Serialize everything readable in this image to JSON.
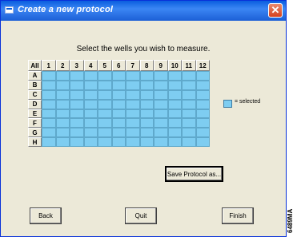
{
  "window": {
    "title": "Create a new protocol",
    "close_label": "✕"
  },
  "instruction": "Select the wells you wish to measure.",
  "grid": {
    "corner_label": "All",
    "columns": [
      "1",
      "2",
      "3",
      "4",
      "5",
      "6",
      "7",
      "8",
      "9",
      "10",
      "11",
      "12"
    ],
    "rows": [
      "A",
      "B",
      "C",
      "D",
      "E",
      "F",
      "G",
      "H"
    ]
  },
  "legend": {
    "label": "= selected",
    "color": "#7ecdf1"
  },
  "buttons": {
    "save_protocol": "Save Protocol as...",
    "back": "Back",
    "quit": "Quit",
    "finish": "Finish"
  },
  "figure_id": "6489MA"
}
